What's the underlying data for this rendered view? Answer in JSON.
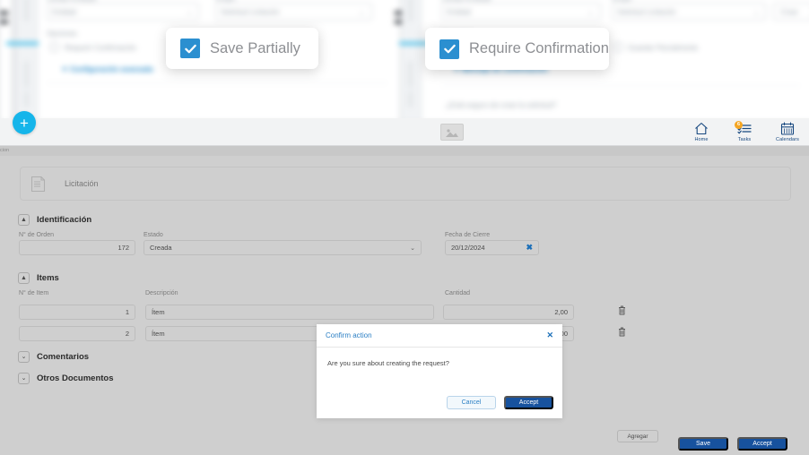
{
  "callouts": [
    {
      "label": "Save Partially",
      "icon": "check-icon",
      "checked": true
    },
    {
      "label": "Require Confirmation",
      "icon": "check-icon",
      "checked": true
    }
  ],
  "toolbar": {
    "add_label": "+",
    "image_placeholder_icon": "image-placeholder-icon",
    "items": [
      {
        "label": "Home",
        "icon": "home-icon",
        "badge": ""
      },
      {
        "label": "Tasks",
        "icon": "tasks-icon",
        "badge": "6"
      },
      {
        "label": "Calendars",
        "icon": "calendar-icon",
        "badge": ""
      }
    ]
  },
  "breadcrumb": "cion",
  "document": {
    "title": "Licitación",
    "icon": "document-icon"
  },
  "sections": {
    "identificacion": {
      "title": "Identificación",
      "collapsed": false,
      "chevron": "▲",
      "fields": {
        "orden_label": "N° de Orden",
        "orden_value": "172",
        "estado_label": "Estado",
        "estado_value": "Creada",
        "estado_caret": "⌄",
        "fecha_label": "Fecha de Cierre",
        "fecha_value": "20/12/2024",
        "fecha_clear": "✖"
      }
    },
    "items": {
      "title": "Items",
      "collapsed": false,
      "chevron": "▲",
      "add_label": "Agregar",
      "columns": [
        "N° de Item",
        "Descripción",
        "Cantidad"
      ],
      "rows": [
        {
          "num": "1",
          "descripcion": "Ítem",
          "cantidad": "2,00",
          "delete_icon": "trash-icon"
        },
        {
          "num": "2",
          "descripcion": "Ítem",
          "cantidad": "2,00",
          "delete_icon": "trash-icon"
        }
      ]
    },
    "comentarios": {
      "title": "Comentarios",
      "collapsed": true,
      "chevron": "⌄"
    },
    "otros_documentos": {
      "title": "Otros Documentos",
      "collapsed": true,
      "chevron": "⌄"
    }
  },
  "modal": {
    "title": "Confirm action",
    "close_icon": "close-icon",
    "message": "Are you sure about creating the request?",
    "cancel_label": "Cancel",
    "accept_label": "Accept"
  },
  "bottom_actions": {
    "save_label": "Save",
    "accept_label": "Accept"
  },
  "colors": {
    "accent_cyan": "#16b5ea",
    "callout_check": "#2b8fd0",
    "primary_button": "#17529e",
    "link_blue": "#2b7fc4",
    "badge_orange": "#f5a623",
    "page_grey": "#cfcfcf"
  },
  "background_blurred": {
    "note": "Blurred application form behind the callouts",
    "texts": [
      "Entidad",
      "Solicitud",
      "Opciones",
      "Requerir Confirmación",
      "Configuración avanzada",
      "Mensaje de confirmación",
      "Guardar Parcialmente",
      "¿Desea seguro de crear la solicitud?",
      "Crear"
    ]
  }
}
